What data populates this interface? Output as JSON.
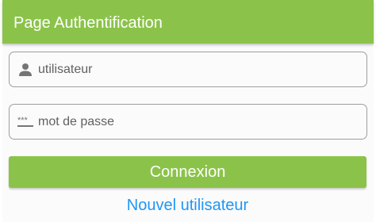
{
  "app_bar": {
    "title": "Page Authentification",
    "color": "#8bc34a"
  },
  "form": {
    "username": {
      "icon": "person-icon",
      "placeholder": "utilisateur",
      "value": ""
    },
    "password": {
      "icon": "password-dots-icon",
      "placeholder": "mot de passe",
      "value": ""
    },
    "login_button": {
      "label": "Connexion",
      "color": "#8bc34a"
    },
    "new_user_link": {
      "label": "Nouvel utilisateur",
      "color": "#2196f3"
    }
  }
}
